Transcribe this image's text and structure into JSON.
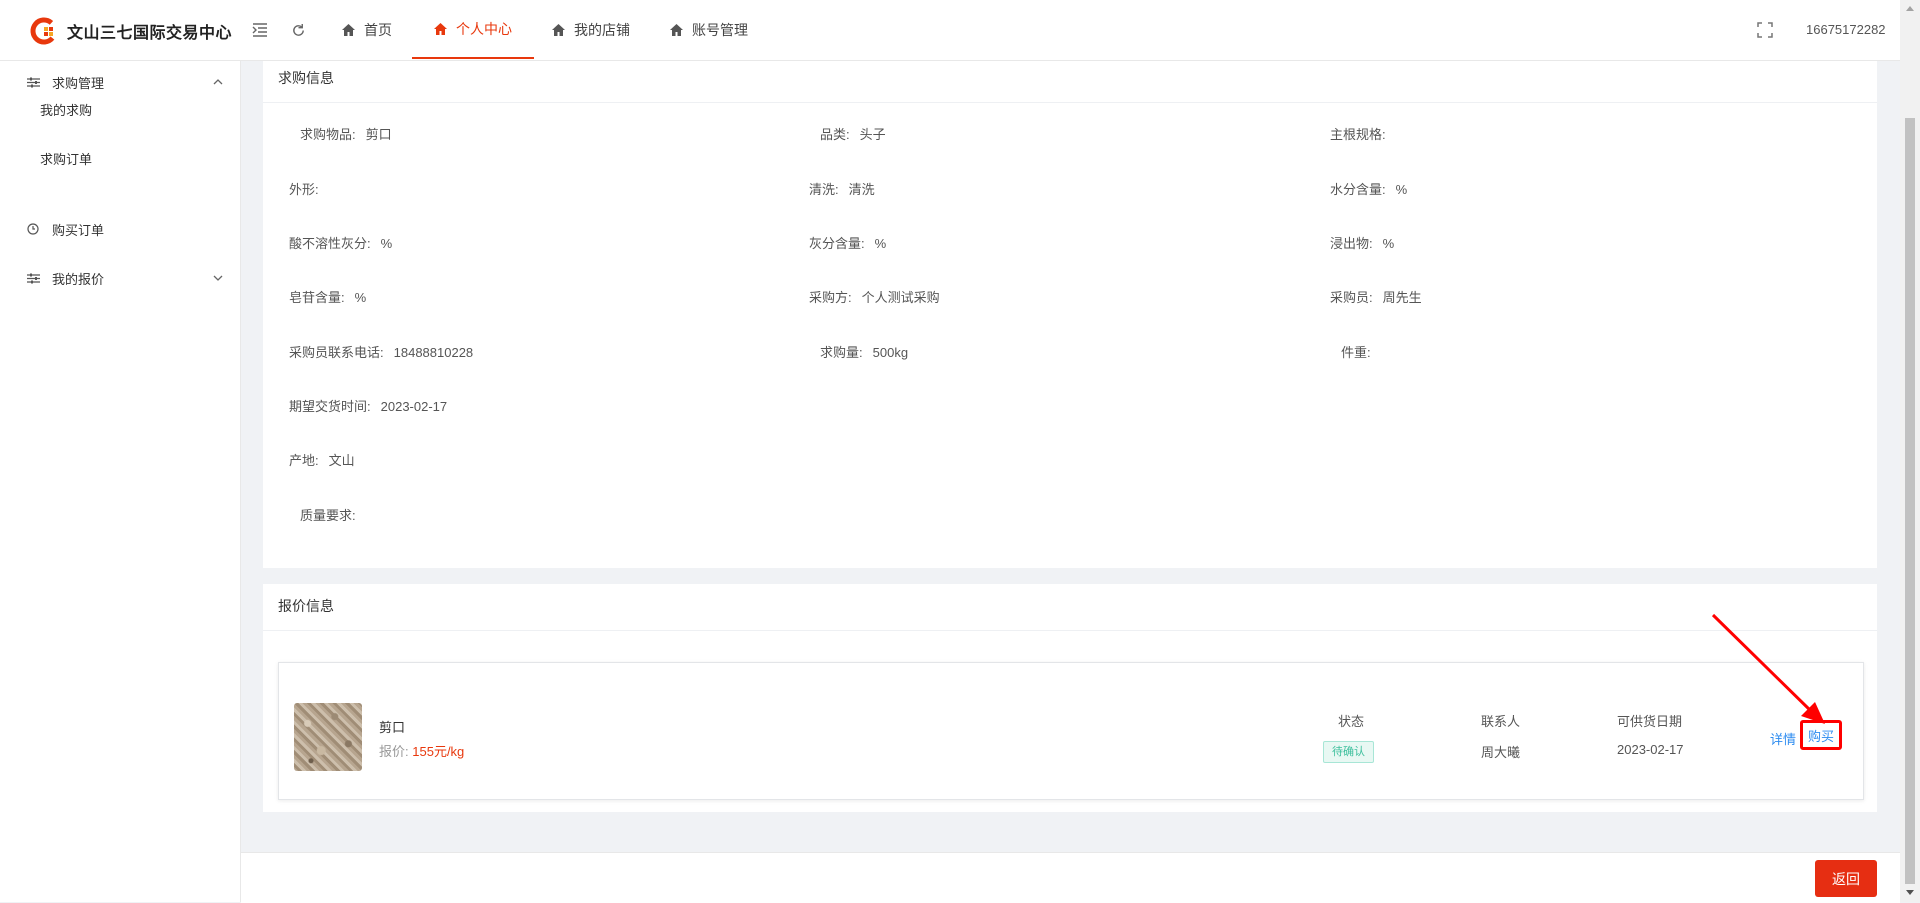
{
  "app": {
    "title": "文山三七国际交易中心",
    "brand_color": "#e8380d"
  },
  "header": {
    "tabs": [
      {
        "label": "首页",
        "icon": "home-icon"
      },
      {
        "label": "个人中心",
        "icon": "home-icon",
        "active": true
      },
      {
        "label": "我的店铺",
        "icon": "home-icon"
      },
      {
        "label": "账号管理",
        "icon": "home-icon"
      }
    ],
    "user_phone": "16675172282"
  },
  "sidebar": {
    "groups": [
      {
        "label": "求购管理",
        "icon": "filter-icon",
        "expanded": true,
        "children": [
          {
            "label": "我的求购"
          },
          {
            "label": "求购订单"
          }
        ]
      },
      {
        "label": "购买订单",
        "icon": "clock-icon"
      },
      {
        "label": "我的报价",
        "icon": "filter-icon",
        "expanded": false
      }
    ]
  },
  "request_info": {
    "title": "求购信息",
    "fields": [
      {
        "label": "求购物品:",
        "value": "剪口"
      },
      {
        "label": "品类:",
        "value": "头子"
      },
      {
        "label": "主根规格:",
        "value": ""
      },
      {
        "label": "外形:",
        "value": ""
      },
      {
        "label": "清洗:",
        "value": "清洗"
      },
      {
        "label": "水分含量:",
        "value": "%"
      },
      {
        "label": "酸不溶性灰分:",
        "value": "%"
      },
      {
        "label": "灰分含量:",
        "value": "%"
      },
      {
        "label": "浸出物:",
        "value": "%"
      },
      {
        "label": "皂苷含量:",
        "value": "%"
      },
      {
        "label": "采购方:",
        "value": "个人测试采购"
      },
      {
        "label": "采购员:",
        "value": "周先生"
      },
      {
        "label": "采购员联系电话:",
        "value": "18488810228"
      },
      {
        "label": "求购量:",
        "value": "500kg"
      },
      {
        "label": "件重:",
        "value": ""
      },
      {
        "label": "期望交货时间:",
        "value": "2023-02-17"
      },
      {
        "label": "产地:",
        "value": "文山"
      },
      {
        "label": "质量要求:",
        "value": ""
      }
    ]
  },
  "quote_info": {
    "title": "报价信息",
    "items": [
      {
        "name": "剪口",
        "price_label": "报价:",
        "price_value": "155元/kg",
        "status_header": "状态",
        "status": "待确认",
        "contact_header": "联系人",
        "contact": "周大曦",
        "date_header": "可供货日期",
        "date": "2023-02-17",
        "detail_label": "详情",
        "buy_label": "购买"
      }
    ]
  },
  "footer": {
    "back_label": "返回"
  }
}
